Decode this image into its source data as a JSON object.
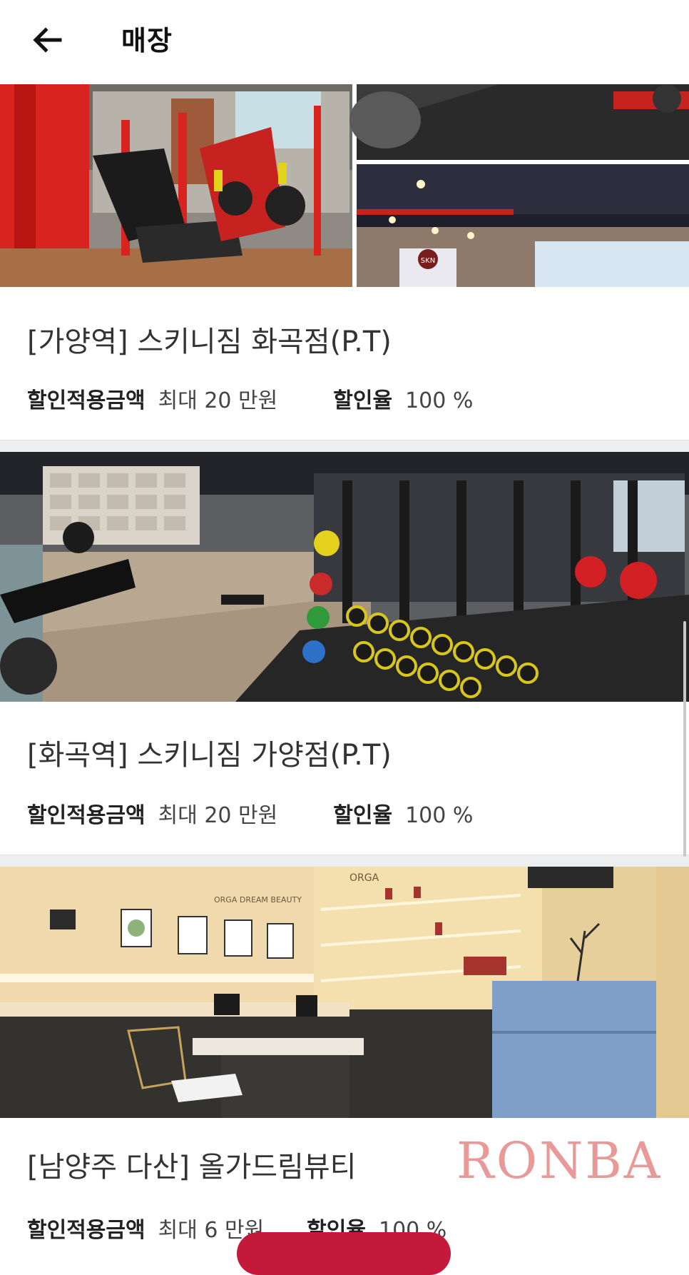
{
  "header": {
    "title": "매장",
    "back_icon": "arrow-left-icon"
  },
  "stores": [
    {
      "name": "[가양역] 스키니짐 화곡점(P.T)",
      "discount_amount_label": "할인적용금액",
      "discount_amount_value": "최대 20 만원",
      "discount_rate_label": "할인율",
      "discount_rate_value": "100 %"
    },
    {
      "name": "[화곡역] 스키니짐 가양점(P.T)",
      "discount_amount_label": "할인적용금액",
      "discount_amount_value": "최대 20 만원",
      "discount_rate_label": "할인율",
      "discount_rate_value": "100 %"
    },
    {
      "name": "[남양주 다산] 올가드림뷰티",
      "discount_amount_label": "할인적용금액",
      "discount_amount_value": "최대 6 만원",
      "discount_rate_label": "할인율",
      "discount_rate_value": "100 %"
    }
  ],
  "photo_text": {
    "gym_sign": "SKN",
    "salon_banner": "ORGA DREAM BEAUTY",
    "salon_top": "ORGA"
  },
  "watermark": "RONBA",
  "colors": {
    "accent": "#c4193a",
    "divider": "#eceeef",
    "gym_red": "#d8231f"
  }
}
